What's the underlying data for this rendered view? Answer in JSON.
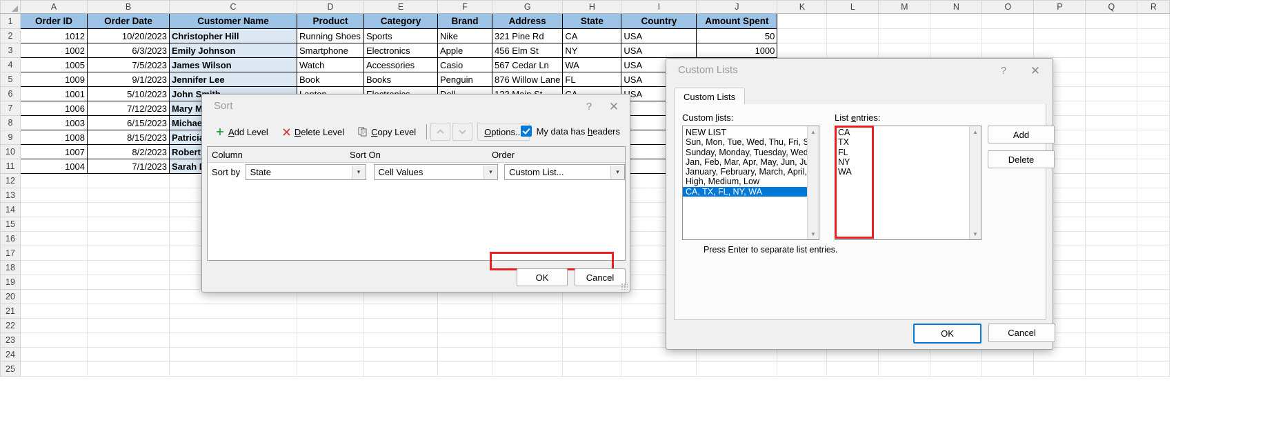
{
  "spreadsheet": {
    "column_letters": [
      "A",
      "B",
      "C",
      "D",
      "E",
      "F",
      "G",
      "H",
      "I",
      "J",
      "K",
      "L",
      "M",
      "N",
      "O",
      "P",
      "Q",
      "R"
    ],
    "row_numbers": [
      1,
      2,
      3,
      4,
      5,
      6,
      7,
      8,
      9,
      10,
      11,
      12,
      13,
      14,
      15,
      16,
      17,
      18,
      19,
      20,
      21,
      22,
      23,
      24,
      25
    ],
    "headers": [
      "Order ID",
      "Order Date",
      "Customer Name",
      "Product",
      "Category",
      "Brand",
      "Address",
      "State",
      "Country",
      "Amount Spent"
    ],
    "rows": [
      {
        "order_id": "1012",
        "order_date": "10/20/2023",
        "customer": "Christopher Hill",
        "product": "Running Shoes",
        "category": "Sports",
        "brand": "Nike",
        "address": "321 Pine Rd",
        "state": "CA",
        "country": "USA",
        "amount": "50"
      },
      {
        "order_id": "1002",
        "order_date": "6/3/2023",
        "customer": "Emily Johnson",
        "product": "Smartphone",
        "category": "Electronics",
        "brand": "Apple",
        "address": "456 Elm St",
        "state": "NY",
        "country": "USA",
        "amount": "1000"
      },
      {
        "order_id": "1005",
        "order_date": "7/5/2023",
        "customer": "James Wilson",
        "product": "Watch",
        "category": "Accessories",
        "brand": "Casio",
        "address": "567 Cedar Ln",
        "state": "WA",
        "country": "USA",
        "amount": ""
      },
      {
        "order_id": "1009",
        "order_date": "9/1/2023",
        "customer": "Jennifer Lee",
        "product": "Book",
        "category": "Books",
        "brand": "Penguin",
        "address": "876 Willow Lane",
        "state": "FL",
        "country": "USA",
        "amount": ""
      },
      {
        "order_id": "1001",
        "order_date": "5/10/2023",
        "customer": "John Smith",
        "product": "Laptop",
        "category": "Electronics",
        "brand": "Dell",
        "address": "123 Main St",
        "state": "CA",
        "country": "USA",
        "amount": ""
      },
      {
        "order_id": "1006",
        "order_date": "7/12/2023",
        "customer": "Mary M",
        "product": "",
        "category": "",
        "brand": "",
        "address": "",
        "state": "",
        "country": "",
        "amount": ""
      },
      {
        "order_id": "1003",
        "order_date": "6/15/2023",
        "customer": "Michae",
        "product": "",
        "category": "",
        "brand": "",
        "address": "",
        "state": "",
        "country": "",
        "amount": ""
      },
      {
        "order_id": "1008",
        "order_date": "8/15/2023",
        "customer": "Patricia",
        "product": "",
        "category": "",
        "brand": "",
        "address": "",
        "state": "",
        "country": "",
        "amount": ""
      },
      {
        "order_id": "1007",
        "order_date": "8/2/2023",
        "customer": "Robert",
        "product": "",
        "category": "",
        "brand": "",
        "address": "",
        "state": "",
        "country": "",
        "amount": ""
      },
      {
        "order_id": "1004",
        "order_date": "7/1/2023",
        "customer": "Sarah D",
        "product": "",
        "category": "",
        "brand": "",
        "address": "",
        "state": "",
        "country": "",
        "amount": ""
      }
    ]
  },
  "sort_dialog": {
    "title": "Sort",
    "help_icon": "?",
    "close_icon": "✕",
    "add_level": "Add Level",
    "delete_level": "Delete Level",
    "copy_level": "Copy Level",
    "move_up_icon": "⌃",
    "move_down_icon": "⌄",
    "options": "Options...",
    "headers_checkbox_label": "My data has headers",
    "headers_checkbox_checked": true,
    "col_header_column": "Column",
    "col_header_sort_on": "Sort On",
    "col_header_order": "Order",
    "sort_by_label": "Sort by",
    "column_value": "State",
    "sort_on_value": "Cell Values",
    "order_value": "Custom List...",
    "ok": "OK",
    "cancel": "Cancel",
    "highlight_color": "#e8201f"
  },
  "custom_lists_dialog": {
    "title": "Custom Lists",
    "help_icon": "?",
    "close_icon": "✕",
    "tab_label": "Custom Lists",
    "custom_lists_label": "Custom lists:",
    "list_entries_label": "List entries:",
    "custom_lists": [
      "NEW LIST",
      "Sun, Mon, Tue, Wed, Thu, Fri, Sat",
      "Sunday, Monday, Tuesday, Wednes",
      "Jan, Feb, Mar, Apr, May, Jun, Jul, Au",
      "January, February, March, April, Ma",
      "High, Medium, Low",
      "CA, TX, FL, NY, WA"
    ],
    "selected_custom_list_index": 6,
    "list_entries": [
      "CA",
      "TX",
      "FL",
      "NY",
      "WA"
    ],
    "add_button": "Add",
    "delete_button": "Delete",
    "hint": "Press Enter to separate list entries.",
    "ok": "OK",
    "cancel": "Cancel",
    "scroll_up_icon": "▲",
    "scroll_down_icon": "▼",
    "highlight_color": "#e8201f",
    "selection_color": "#0078d7"
  }
}
